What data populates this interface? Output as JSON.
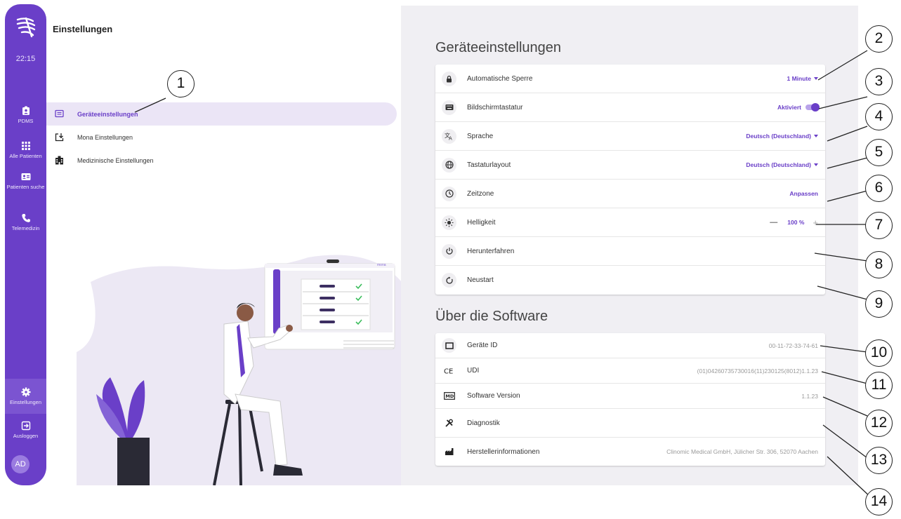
{
  "rail": {
    "time": "22:15",
    "items": [
      {
        "label": "PDMS",
        "icon": "clipboard-user-icon"
      },
      {
        "label": "Alle Patienten",
        "icon": "grid-icon"
      },
      {
        "label": "Patienten suche",
        "icon": "patient-card-icon"
      },
      {
        "label": "Telemedizin",
        "icon": "phone-icon"
      }
    ],
    "bottom": [
      {
        "label": "Einstellungen",
        "icon": "gear-icon",
        "active": true
      },
      {
        "label": "Ausloggen",
        "icon": "logout-icon"
      }
    ],
    "avatar": "AD"
  },
  "page_title": "Einstellungen",
  "nav": [
    {
      "label": "Geräteeinstellungen",
      "icon": "device-settings-icon",
      "selected": true
    },
    {
      "label": "Mona Einstellungen",
      "icon": "mona-download-icon"
    },
    {
      "label": "Medizinische Einstellungen",
      "icon": "hospital-icon"
    }
  ],
  "illustration": {
    "brand": "mona"
  },
  "device": {
    "title": "Geräteeinstellungen",
    "rows": [
      {
        "label": "Automatische Sperre",
        "value": "1 Minute",
        "icon": "lock-icon"
      },
      {
        "label": "Bildschirmtastatur",
        "value": "Aktiviert",
        "icon": "keyboard-icon"
      },
      {
        "label": "Sprache",
        "value": "Deutsch (Deutschland)",
        "icon": "translate-icon"
      },
      {
        "label": "Tastaturlayout",
        "value": "Deutsch (Deutschland)",
        "icon": "globe-icon"
      },
      {
        "label": "Zeitzone",
        "value": "Anpassen",
        "icon": "clock-icon"
      },
      {
        "label": "Helligkeit",
        "value": "100 %",
        "minus": "—",
        "plus": "+",
        "icon": "brightness-icon"
      },
      {
        "label": "Herunterfahren",
        "icon": "power-icon"
      },
      {
        "label": "Neustart",
        "icon": "restart-icon"
      }
    ]
  },
  "software": {
    "title": "Über die Software",
    "rows": [
      {
        "label": "Geräte ID",
        "value": "00-11-72-33-74-61",
        "icon": "device-id-icon"
      },
      {
        "label": "UDI",
        "value": "(01)04260735730016(11)230125(8012)1.1.23",
        "icon": "ce-mark-icon"
      },
      {
        "label": "Software Version",
        "value": "1.1.23",
        "icon": "md-badge-icon"
      },
      {
        "label": "Diagnostik",
        "icon": "tools-icon"
      },
      {
        "label": "Herstellerinformationen",
        "value": "Clinomic Medical GmbH, Jülicher Str. 306, 52070 Aachen",
        "icon": "factory-icon"
      }
    ]
  },
  "callouts": [
    "1",
    "2",
    "3",
    "4",
    "5",
    "6",
    "7",
    "8",
    "9",
    "10",
    "11",
    "12",
    "13",
    "14"
  ],
  "colors": {
    "accent": "#6a3fc8",
    "rail": "#6a3fc8",
    "selected_bg": "#ebe5f6",
    "panel_bg": "#f0eff3"
  }
}
